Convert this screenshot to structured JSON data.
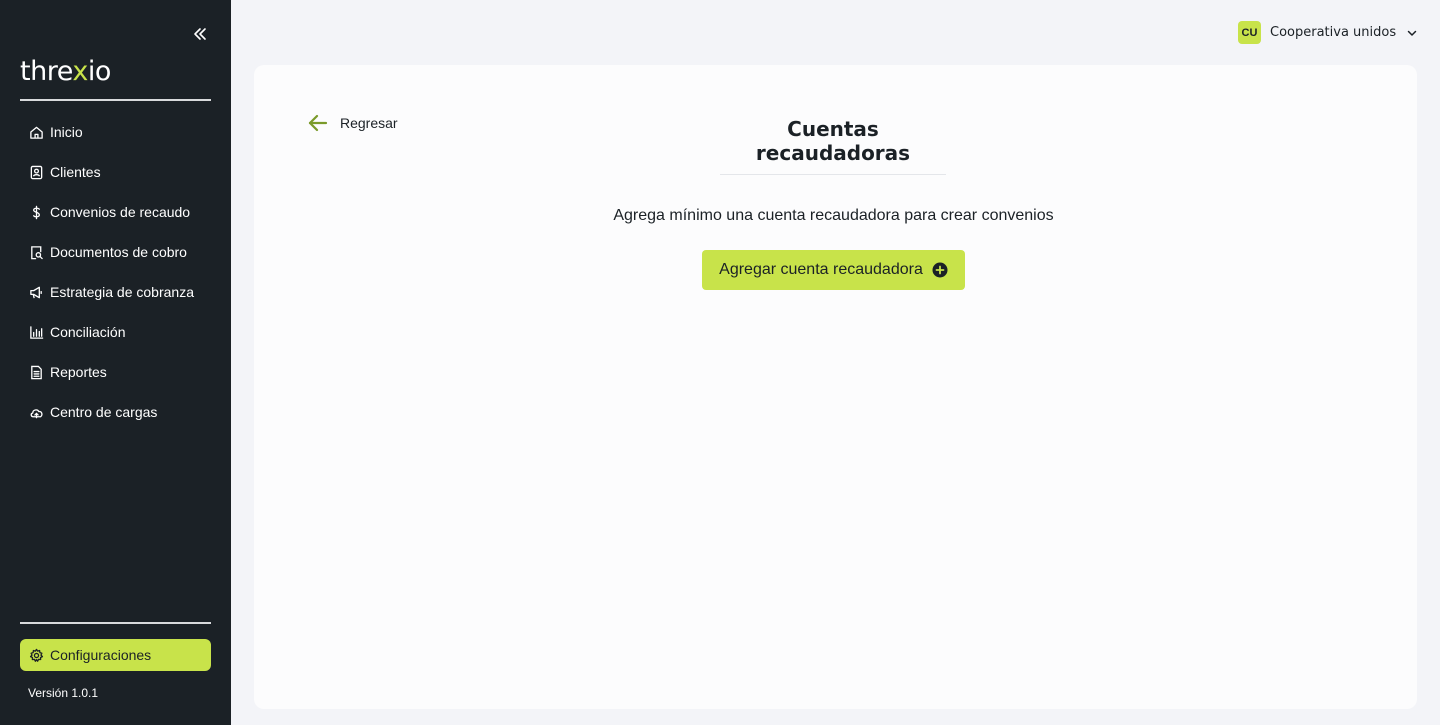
{
  "sidebar": {
    "logo": {
      "prefix": "thre",
      "accent": "x",
      "suffix": "io"
    },
    "items": [
      {
        "label": "Inicio",
        "icon": "home-icon"
      },
      {
        "label": "Clientes",
        "icon": "contact-card-icon"
      },
      {
        "label": "Convenios de recaudo",
        "icon": "dollar-icon"
      },
      {
        "label": "Documentos de cobro",
        "icon": "document-search-icon"
      },
      {
        "label": "Estrategia de cobranza",
        "icon": "megaphone-icon"
      },
      {
        "label": "Conciliación",
        "icon": "bar-chart-icon"
      },
      {
        "label": "Reportes",
        "icon": "report-icon"
      },
      {
        "label": "Centro de cargas",
        "icon": "cloud-upload-icon"
      }
    ],
    "settings": {
      "label": "Configuraciones",
      "icon": "gear-icon"
    },
    "version": "Versión 1.0.1"
  },
  "header": {
    "account_initials": "CU",
    "account_name": "Cooperativa unidos"
  },
  "main": {
    "back_label": "Regresar",
    "title": "Cuentas recaudadoras",
    "hint": "Agrega mínimo una cuenta recaudadora para crear convenios",
    "add_button_label": "Agregar cuenta recaudadora"
  },
  "colors": {
    "sidebar_bg": "#1b2126",
    "accent": "#c8e34a",
    "page_bg": "#f3f4f8",
    "card_bg": "#fcfcfd",
    "back_arrow": "#7a9a2a"
  }
}
